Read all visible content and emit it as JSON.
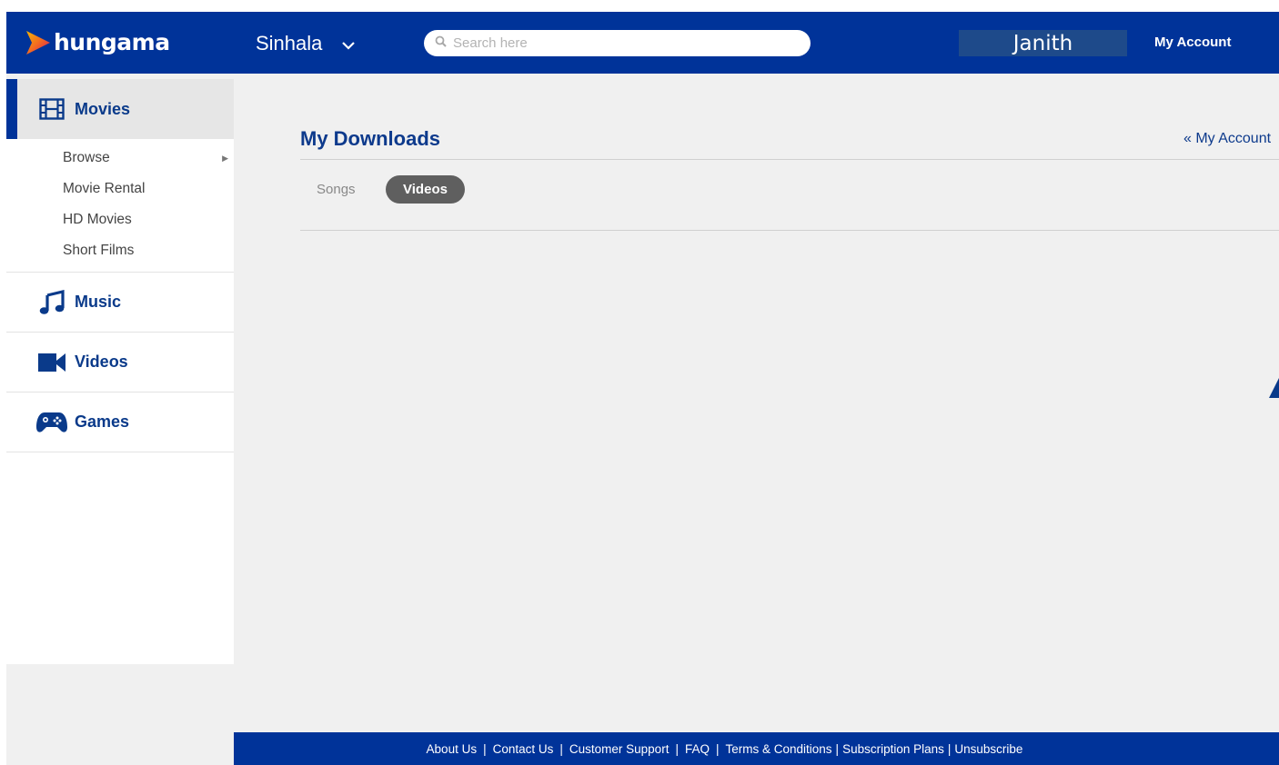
{
  "header": {
    "logo_text": "hungama",
    "language": "Sinhala",
    "search_placeholder": "Search here",
    "user_name": "Janith",
    "my_account": "My Account"
  },
  "sidebar": {
    "categories": [
      {
        "label": "Movies",
        "icon": "film-icon",
        "active": true
      },
      {
        "label": "Music",
        "icon": "music-note-icon",
        "active": false
      },
      {
        "label": "Videos",
        "icon": "video-camera-icon",
        "active": false
      },
      {
        "label": "Games",
        "icon": "gamepad-icon",
        "active": false
      }
    ],
    "movies_submenu": [
      {
        "label": "Browse",
        "has_arrow": true
      },
      {
        "label": "Movie Rental"
      },
      {
        "label": "HD Movies"
      },
      {
        "label": "Short Films"
      }
    ]
  },
  "main": {
    "title": "My Downloads",
    "back_link": "« My Account",
    "tabs": [
      {
        "label": "Songs",
        "active": false
      },
      {
        "label": "Videos",
        "active": true
      }
    ]
  },
  "footer": {
    "links": [
      "About Us",
      "Contact Us",
      "Customer Support",
      "FAQ",
      "Terms & Conditions",
      "Subscription Plans",
      "Unsubscribe"
    ]
  },
  "colors": {
    "brand_blue": "#003399",
    "nav_text": "#0a3a8a",
    "active_tab_bg": "#5f5f5f",
    "page_bg": "#f0f0f0"
  }
}
